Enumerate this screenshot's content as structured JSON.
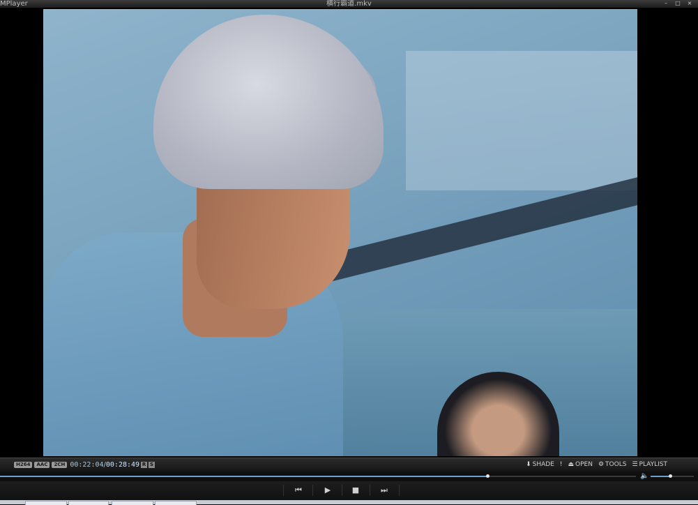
{
  "window": {
    "app_name": "MPlayer",
    "title": "横行霸道.mkv",
    "controls": {
      "minimize": "–",
      "maximize": "□",
      "close": "×"
    }
  },
  "status": {
    "badges": [
      "H264",
      "AAC",
      "2CH"
    ],
    "time_current": "00:22:04",
    "time_separator": "/",
    "time_total": "00:28:49",
    "mini_badges": [
      "R",
      "S"
    ]
  },
  "tools": [
    {
      "icon": "download-icon",
      "glyph": "⬇",
      "label": "SHADE"
    },
    {
      "icon": "exclamation-icon",
      "glyph": "!",
      "label": ""
    },
    {
      "icon": "eject-icon",
      "glyph": "⏏",
      "label": "OPEN"
    },
    {
      "icon": "gear-icon",
      "glyph": "⚙",
      "label": "TOOLS"
    },
    {
      "icon": "list-icon",
      "glyph": "☰",
      "label": "PLAYLIST"
    }
  ],
  "seek": {
    "progress": 0.766
  },
  "volume": {
    "level": 0.45
  },
  "transport": {
    "prev": {
      "icon": "skip-back-icon",
      "glyph": "⏮"
    },
    "play": {
      "icon": "play-icon",
      "glyph": "▶"
    },
    "stop": {
      "icon": "stop-icon",
      "glyph": "■"
    },
    "next": {
      "icon": "skip-forward-icon",
      "glyph": "⏭"
    }
  }
}
